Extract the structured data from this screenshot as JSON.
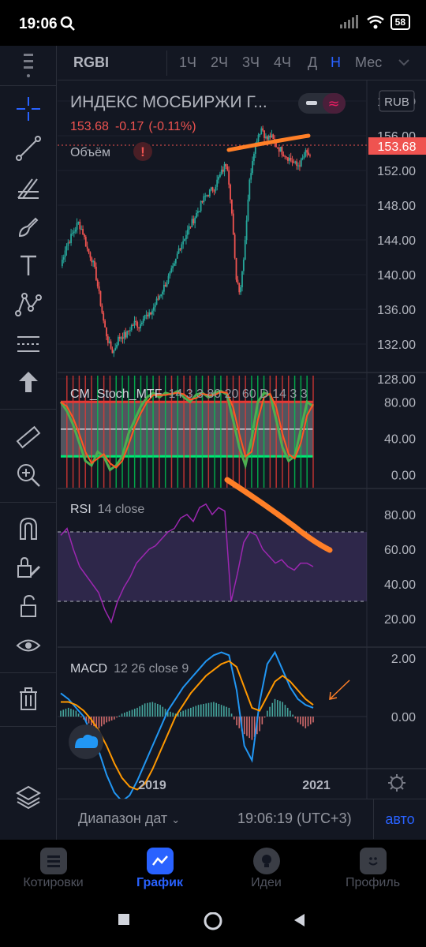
{
  "status_bar": {
    "time": "19:06",
    "battery": "58"
  },
  "top_bar": {
    "symbol": "RGBI",
    "timeframes": [
      "1Ч",
      "2Ч",
      "3Ч",
      "4Ч",
      "Д",
      "Н",
      "Мес"
    ],
    "active_timeframe": "Н"
  },
  "main_pane": {
    "title": "ИНДЕКС МОСБИРЖИ Г...",
    "price": "153.68",
    "change": "-0.17",
    "change_pct": "(-0.11%)",
    "volume_label": "Объём",
    "currency": "RUB",
    "last_price_badge": "153.68",
    "price_ticks": [
      "160.00",
      "156.00",
      "152.00",
      "148.00",
      "144.00",
      "140.00",
      "136.00",
      "132.00",
      "128.00"
    ]
  },
  "stoch_pane": {
    "name": "CM_Stoch_MTF",
    "params": "14 3 3 80 20 60 D 14 3 3",
    "ticks": [
      "80.00",
      "40.00",
      "0.00"
    ]
  },
  "rsi_pane": {
    "name": "RSI",
    "params": "14 close",
    "ticks": [
      "80.00",
      "60.00",
      "40.00",
      "20.00"
    ]
  },
  "macd_pane": {
    "name": "MACD",
    "params": "12 26 close 9",
    "ticks": [
      "2.00",
      "0.00"
    ]
  },
  "time_axis": {
    "labels": [
      "2019",
      "2021"
    ]
  },
  "bottom_bar": {
    "date_range": "Диапазон дат",
    "clock": "19:06:19 (UTC+3)",
    "auto": "авто"
  },
  "nav": {
    "items": [
      "Котировки",
      "График",
      "Идеи",
      "Профиль"
    ],
    "active": "График"
  },
  "colors": {
    "background": "#131722",
    "up": "#26a69a",
    "down": "#ef5350",
    "accent": "#2962ff",
    "rsi": "#9c27b0",
    "annotation": "#ff7f27",
    "macd": "#2196f3",
    "signal": "#ff9800"
  },
  "chart_data": [
    {
      "type": "candlestick",
      "title": "ИНДЕКС МОСБИРЖИ Г...",
      "ylim": [
        128,
        160
      ],
      "y_ticks": [
        160,
        156,
        152,
        148,
        144,
        140,
        136,
        132,
        128
      ],
      "x_labels": [
        "2019",
        "2021"
      ],
      "last": 153.68,
      "close_path": [
        141,
        143,
        144,
        145,
        146,
        145,
        143,
        142,
        140,
        137,
        134,
        132,
        131,
        132.5,
        133,
        133,
        134,
        134.5,
        134,
        135.5,
        135,
        136,
        137,
        138,
        139,
        140,
        141,
        143,
        144,
        145,
        146,
        147,
        148,
        149,
        149.5,
        150,
        151,
        152,
        153,
        148,
        140,
        138,
        143,
        150,
        154,
        156,
        157,
        155.5,
        156,
        155,
        154.5,
        154,
        153.5,
        153,
        152.5,
        153,
        154,
        153.68
      ]
    },
    {
      "type": "line",
      "title": "CM_Stoch_MTF",
      "ylim": [
        -5,
        95
      ],
      "y_ticks": [
        80,
        40,
        0
      ],
      "bands": [
        20,
        80
      ],
      "series": [
        {
          "values": [
            80,
            70,
            55,
            35,
            15,
            10,
            25,
            20,
            5,
            10,
            20,
            45,
            60,
            75,
            85,
            90,
            85,
            90,
            88,
            92,
            85,
            80,
            88,
            90,
            85,
            90,
            92,
            88,
            60,
            30,
            10,
            40,
            80,
            90,
            88,
            60,
            30,
            15,
            20,
            50,
            80,
            75
          ]
        }
      ]
    },
    {
      "type": "line",
      "title": "RSI",
      "ylim": [
        12,
        88
      ],
      "y_ticks": [
        80,
        60,
        40,
        20
      ],
      "bands": [
        30,
        70
      ],
      "series": [
        {
          "values": [
            68,
            72,
            60,
            50,
            45,
            40,
            35,
            25,
            18,
            30,
            38,
            44,
            52,
            56,
            60,
            62,
            66,
            70,
            72,
            78,
            80,
            76,
            84,
            86,
            80,
            84,
            82,
            30,
            46,
            64,
            70,
            68,
            60,
            56,
            52,
            54,
            50,
            48,
            52,
            52,
            50
          ]
        }
      ]
    },
    {
      "type": "bar",
      "title": "MACD",
      "ylim": [
        -3,
        2.2
      ],
      "y_ticks": [
        2,
        0
      ],
      "series": [
        {
          "values": [
            0.8,
            0.6,
            0.3,
            0.0,
            -0.6,
            -1.2,
            -2.0,
            -2.6,
            -2.9,
            -2.7,
            -2.2,
            -1.6,
            -1.0,
            -0.4,
            0.2,
            0.6,
            1.0,
            1.3,
            1.6,
            1.9,
            2.1,
            2.2,
            2.1,
            0.9,
            -1.0,
            -1.5,
            0.5,
            1.8,
            2.2,
            1.6,
            1.0,
            0.6,
            0.4,
            0.3
          ]
        },
        {
          "values": [
            0.5,
            0.5,
            0.4,
            0.2,
            -0.1,
            -0.5,
            -1.0,
            -1.6,
            -2.1,
            -2.4,
            -2.5,
            -2.3,
            -1.8,
            -1.2,
            -0.6,
            0.0,
            0.4,
            0.8,
            1.1,
            1.4,
            1.6,
            1.8,
            1.9,
            1.7,
            1.0,
            0.3,
            0.2,
            0.7,
            1.2,
            1.4,
            1.2,
            0.9,
            0.6,
            0.4
          ]
        },
        {
          "values": [
            0.2,
            0.3,
            0.2,
            -0.1,
            -0.3,
            -0.4,
            -0.2,
            -0.1,
            0.1,
            0.2,
            0.3,
            0.45,
            0.5,
            0.4,
            0.2,
            0.1,
            0.2,
            0.3,
            0.4,
            0.45,
            0.5,
            0.4,
            0.3,
            -0.3,
            -0.6,
            -0.8,
            -0.5,
            0.2,
            0.6,
            0.5,
            0.2,
            -0.2,
            -0.4,
            -0.2
          ]
        }
      ]
    }
  ]
}
